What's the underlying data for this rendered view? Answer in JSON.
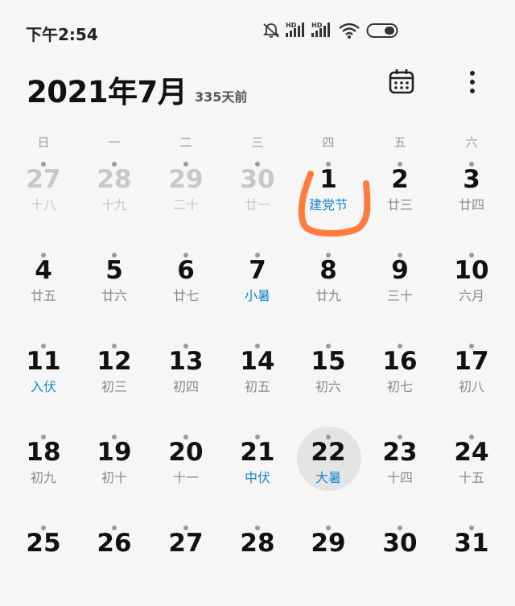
{
  "status_bar": {
    "time": "下午2:54",
    "icons": [
      "mute-icon",
      "signal-hd-1-icon",
      "signal-hd-2-icon",
      "wifi-icon",
      "battery-icon"
    ],
    "hd_label_1": "HD",
    "hd_label_2": "HD"
  },
  "header": {
    "title": "2021年7月",
    "subtitle": "335天前",
    "calendar_button_icon": "calendar-icon",
    "more_button_icon": "more-vertical-icon"
  },
  "weekdays": [
    "日",
    "一",
    "二",
    "三",
    "四",
    "五",
    "六"
  ],
  "colors": {
    "accent": "#1a86d0",
    "today_bg": "#e4e4e4",
    "annotation": "#ff7a3c",
    "faded": "#c8c8c8",
    "lunar": "#8a8a8a"
  },
  "weeks": [
    [
      {
        "day": "27",
        "sub": "十八",
        "faded": true
      },
      {
        "day": "28",
        "sub": "十九",
        "faded": true
      },
      {
        "day": "29",
        "sub": "二十",
        "faded": true
      },
      {
        "day": "30",
        "sub": "廿一",
        "faded": true
      },
      {
        "day": "1",
        "sub": "建党节",
        "accent": true
      },
      {
        "day": "2",
        "sub": "廿三"
      },
      {
        "day": "3",
        "sub": "廿四"
      }
    ],
    [
      {
        "day": "4",
        "sub": "廿五"
      },
      {
        "day": "5",
        "sub": "廿六"
      },
      {
        "day": "6",
        "sub": "廿七"
      },
      {
        "day": "7",
        "sub": "小暑",
        "accent": true
      },
      {
        "day": "8",
        "sub": "廿九"
      },
      {
        "day": "9",
        "sub": "三十"
      },
      {
        "day": "10",
        "sub": "六月"
      }
    ],
    [
      {
        "day": "11",
        "sub": "入伏",
        "accent": true
      },
      {
        "day": "12",
        "sub": "初三"
      },
      {
        "day": "13",
        "sub": "初四"
      },
      {
        "day": "14",
        "sub": "初五"
      },
      {
        "day": "15",
        "sub": "初六"
      },
      {
        "day": "16",
        "sub": "初七"
      },
      {
        "day": "17",
        "sub": "初八"
      }
    ],
    [
      {
        "day": "18",
        "sub": "初九"
      },
      {
        "day": "19",
        "sub": "初十"
      },
      {
        "day": "20",
        "sub": "十一"
      },
      {
        "day": "21",
        "sub": "中伏",
        "accent": true
      },
      {
        "day": "22",
        "sub": "大暑",
        "accent": true,
        "today": true
      },
      {
        "day": "23",
        "sub": "十四"
      },
      {
        "day": "24",
        "sub": "十五"
      }
    ],
    [
      {
        "day": "25",
        "sub": ""
      },
      {
        "day": "26",
        "sub": ""
      },
      {
        "day": "27",
        "sub": ""
      },
      {
        "day": "28",
        "sub": ""
      },
      {
        "day": "29",
        "sub": ""
      },
      {
        "day": "30",
        "sub": ""
      },
      {
        "day": "31",
        "sub": ""
      }
    ]
  ]
}
